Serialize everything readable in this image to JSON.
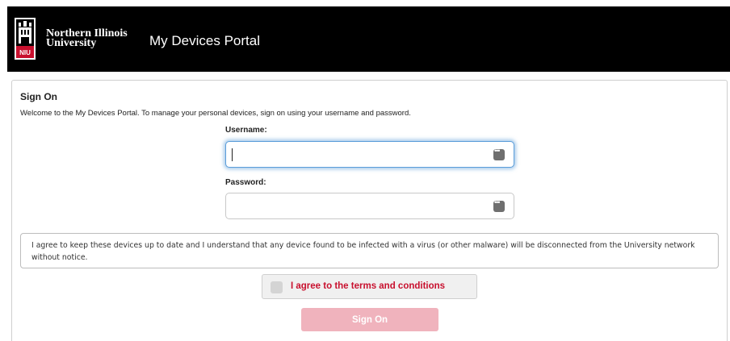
{
  "header": {
    "logo_line1": "Northern Illinois",
    "logo_line2": "University",
    "logo_badge": "NIU",
    "portal_title": "My Devices Portal"
  },
  "signon": {
    "heading": "Sign On",
    "welcome": "Welcome to the My Devices Portal. To manage your personal devices, sign on using your username and password.",
    "username_label": "Username:",
    "username_value": "",
    "password_label": "Password:",
    "password_value": "",
    "agreement_text": "I agree to keep these devices up to date and I understand that any device found to be infected with a virus (or other malware) will be disconnected from the University network without notice.",
    "terms_label": "I agree to the terms and conditions",
    "terms_checked": false,
    "button_label": "Sign On"
  },
  "colors": {
    "header_bg": "#000000",
    "accent_red": "#c8102e",
    "button_disabled": "#f0b3bd",
    "focus_blue": "#5b9dd9"
  },
  "icons": {
    "logo": "niu-castle-logo-icon",
    "field_menu": "password-manager-icon"
  }
}
